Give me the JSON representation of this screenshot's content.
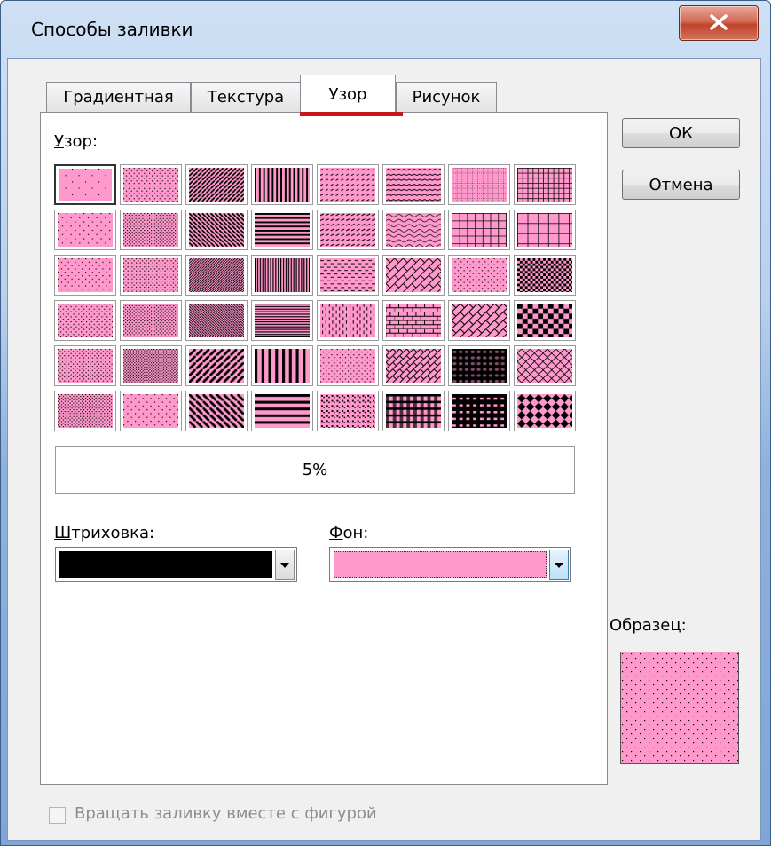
{
  "window": {
    "title": "Способы заливки",
    "close_icon": "close-icon"
  },
  "tabs": [
    {
      "label": "Градиентная",
      "active": false
    },
    {
      "label": "Текстура",
      "active": false
    },
    {
      "label": "Узор",
      "active": true
    },
    {
      "label": "Рисунок",
      "active": false
    }
  ],
  "pattern": {
    "label_key": "У",
    "label_rest": "зор:",
    "selected_pattern": "5%",
    "grid_cell_count": 48,
    "foreground_color": "#000000",
    "background_color": "#ff99cc"
  },
  "hatching": {
    "label_key": "Ш",
    "label_rest": "триховка:",
    "value_color": "#000000"
  },
  "background": {
    "label_key": "Ф",
    "label_rest": "он:",
    "value_color": "#ff99cc"
  },
  "buttons": {
    "ok": "ОК",
    "cancel": "Отмена"
  },
  "sample": {
    "label": "Образец:",
    "pattern": "5%"
  },
  "rotate": {
    "label": "Вращать заливку вместе с фигурой",
    "checked": false,
    "enabled": false
  },
  "colors": {
    "accent_underline": "#c8161d",
    "pink": "#ff99cc"
  }
}
